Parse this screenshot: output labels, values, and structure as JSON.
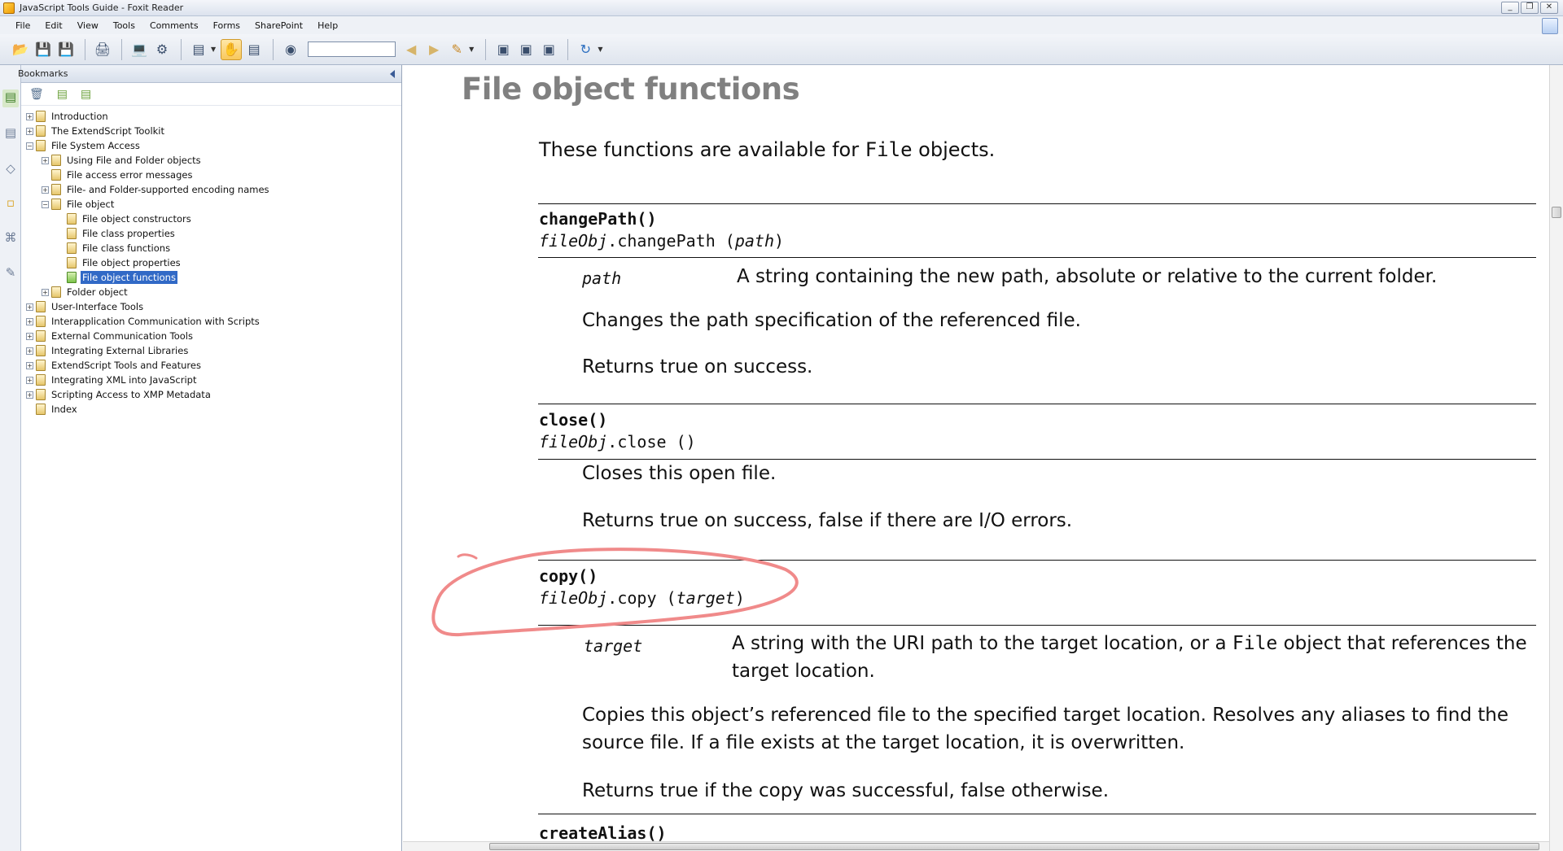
{
  "window": {
    "title": "JavaScript Tools Guide - Foxit Reader",
    "controls": [
      "_",
      "❐",
      "✕"
    ]
  },
  "menu": [
    "File",
    "Edit",
    "View",
    "Tools",
    "Comments",
    "Forms",
    "SharePoint",
    "Help"
  ],
  "toolbar": {
    "search_value": ""
  },
  "bookmarks": {
    "title": "Bookmarks",
    "items": [
      {
        "label": "Introduction",
        "level": 0,
        "toggle": "+",
        "selected": false
      },
      {
        "label": "The ExtendScript Toolkit",
        "level": 0,
        "toggle": "+",
        "selected": false
      },
      {
        "label": "File System Access",
        "level": 0,
        "toggle": "−",
        "selected": false
      },
      {
        "label": "Using File and Folder objects",
        "level": 1,
        "toggle": "+",
        "selected": false
      },
      {
        "label": "File access error messages",
        "level": 1,
        "toggle": "",
        "selected": false
      },
      {
        "label": "File- and Folder-supported encoding names",
        "level": 1,
        "toggle": "+",
        "selected": false
      },
      {
        "label": "File object",
        "level": 1,
        "toggle": "−",
        "selected": false
      },
      {
        "label": "File object constructors",
        "level": 2,
        "toggle": "",
        "selected": false
      },
      {
        "label": "File class properties",
        "level": 2,
        "toggle": "",
        "selected": false
      },
      {
        "label": "File class functions",
        "level": 2,
        "toggle": "",
        "selected": false
      },
      {
        "label": "File object properties",
        "level": 2,
        "toggle": "",
        "selected": false
      },
      {
        "label": "File object functions",
        "level": 2,
        "toggle": "",
        "selected": true
      },
      {
        "label": "Folder object",
        "level": 1,
        "toggle": "+",
        "selected": false
      },
      {
        "label": "User-Interface Tools",
        "level": 0,
        "toggle": "+",
        "selected": false
      },
      {
        "label": "Interapplication Communication with Scripts",
        "level": 0,
        "toggle": "+",
        "selected": false
      },
      {
        "label": "External Communication Tools",
        "level": 0,
        "toggle": "+",
        "selected": false
      },
      {
        "label": "Integrating External Libraries",
        "level": 0,
        "toggle": "+",
        "selected": false
      },
      {
        "label": "ExtendScript Tools and Features",
        "level": 0,
        "toggle": "+",
        "selected": false
      },
      {
        "label": "Integrating XML into JavaScript",
        "level": 0,
        "toggle": "+",
        "selected": false
      },
      {
        "label": "Scripting Access to XMP Metadata",
        "level": 0,
        "toggle": "+",
        "selected": false
      },
      {
        "label": "Index",
        "level": 0,
        "toggle": "",
        "selected": false
      }
    ]
  },
  "document": {
    "heading": "File object functions",
    "intro_before": "These functions are available for ",
    "intro_code": "File",
    "intro_after": " objects.",
    "changePath": {
      "name": "changePath()",
      "sig_obj": "fileObj",
      "sig_method": ".changePath (",
      "sig_arg": "path",
      "sig_close": ")",
      "param": "path",
      "param_desc": "A string containing the new path, absolute or relative to the current folder.",
      "desc": "Changes the path specification of the referenced file.",
      "returns": "Returns true on success."
    },
    "close": {
      "name": "close()",
      "sig_obj": "fileObj",
      "sig_method": ".close ()",
      "desc": "Closes this open file.",
      "returns": "Returns true on success, false if there are I/O errors."
    },
    "copy": {
      "name": "copy()",
      "sig_obj": "fileObj",
      "sig_method": ".copy (",
      "sig_arg": "target",
      "sig_close": ")",
      "param": "target",
      "param_desc_1a": "A string with the URI path to the target location, or a ",
      "param_desc_1code": "File",
      "param_desc_1b": " object that references the",
      "param_desc_2": "target location.",
      "desc_1": "Copies this object’s referenced file to the specified target location. Resolves any aliases to find the",
      "desc_2": "source file. If a file exists at the target location, it is overwritten.",
      "returns": "Returns true if the copy was successful, false otherwise."
    },
    "createAlias": {
      "name": "createAlias()"
    }
  },
  "colors": {
    "annotation": "#f08a8a",
    "selection": "#3169c6",
    "heading": "#808080"
  }
}
